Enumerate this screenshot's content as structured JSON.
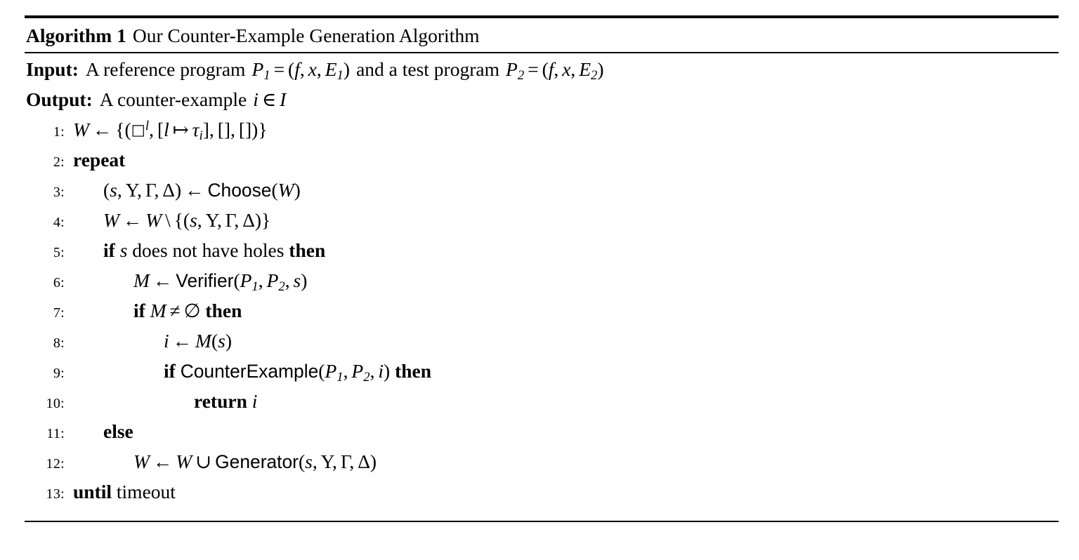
{
  "algorithm": {
    "caption_label": "Algorithm 1",
    "caption_title": "Our Counter-Example Generation Algorithm",
    "io": [
      {
        "label": "Input:",
        "text": "A reference program P₁ = (f, x, E₁) and a test program P₂ = (f, x, E₂)"
      },
      {
        "label": "Output:",
        "text": "A counter-example i ∈ I"
      }
    ],
    "lines": [
      {
        "no": "1:",
        "indent": 0,
        "code": "W ← {(□ᵉ, [l ↦ τᵢ], [], [])}"
      },
      {
        "no": "2:",
        "indent": 0,
        "code": "repeat"
      },
      {
        "no": "3:",
        "indent": 1,
        "code": "(s, Υ, Γ, Δ) ← Choose(W)"
      },
      {
        "no": "4:",
        "indent": 1,
        "code": "W ← W \\ {(s, Υ, Γ, Δ)}"
      },
      {
        "no": "5:",
        "indent": 1,
        "code": "if s does not have holes then"
      },
      {
        "no": "6:",
        "indent": 2,
        "code": "M ← Verifier(P₁, P₂, s)"
      },
      {
        "no": "7:",
        "indent": 2,
        "code": "if M ≠ ∅ then"
      },
      {
        "no": "8:",
        "indent": 3,
        "code": "i ← M(s)"
      },
      {
        "no": "9:",
        "indent": 3,
        "code": "if CounterExample(P₁, P₂, i) then"
      },
      {
        "no": "10:",
        "indent": 4,
        "code": "return i"
      },
      {
        "no": "11:",
        "indent": 1,
        "code": "else"
      },
      {
        "no": "12:",
        "indent": 2,
        "code": "W ← W ∪ Generator(s, Υ, Γ, Δ)"
      },
      {
        "no": "13:",
        "indent": 0,
        "code": "until timeout"
      }
    ],
    "keywords": {
      "repeat": "repeat",
      "if": "if",
      "then": "then",
      "else": "else",
      "until": "until",
      "return": "return"
    },
    "procedures": {
      "choose": "Choose",
      "verifier": "Verifier",
      "counter_example": "CounterExample",
      "generator": "Generator"
    },
    "symbols": {
      "assign": "←",
      "mapsto": "↦",
      "setminus": "\\",
      "union": "∪",
      "neq": "≠",
      "emptyset": "∅",
      "elem": "∈",
      "hole": "□",
      "tau": "τ",
      "upsilon": "Υ",
      "gamma": "Γ",
      "delta": "Δ",
      "equals": "="
    },
    "variables": {
      "W": "W",
      "s": "s",
      "M": "M",
      "i": "i",
      "l": "l",
      "f": "f",
      "x": "x",
      "P": "P",
      "E": "E",
      "I": "I"
    },
    "words": {
      "does_not_have_holes": "does not have holes",
      "timeout": "timeout",
      "a_reference_program": "A reference program",
      "and_a_test_program": "and a test program",
      "a_counter_example": "A counter-example"
    },
    "colors": {
      "text": "#000000",
      "background": "#ffffff",
      "rule": "#000000"
    }
  }
}
